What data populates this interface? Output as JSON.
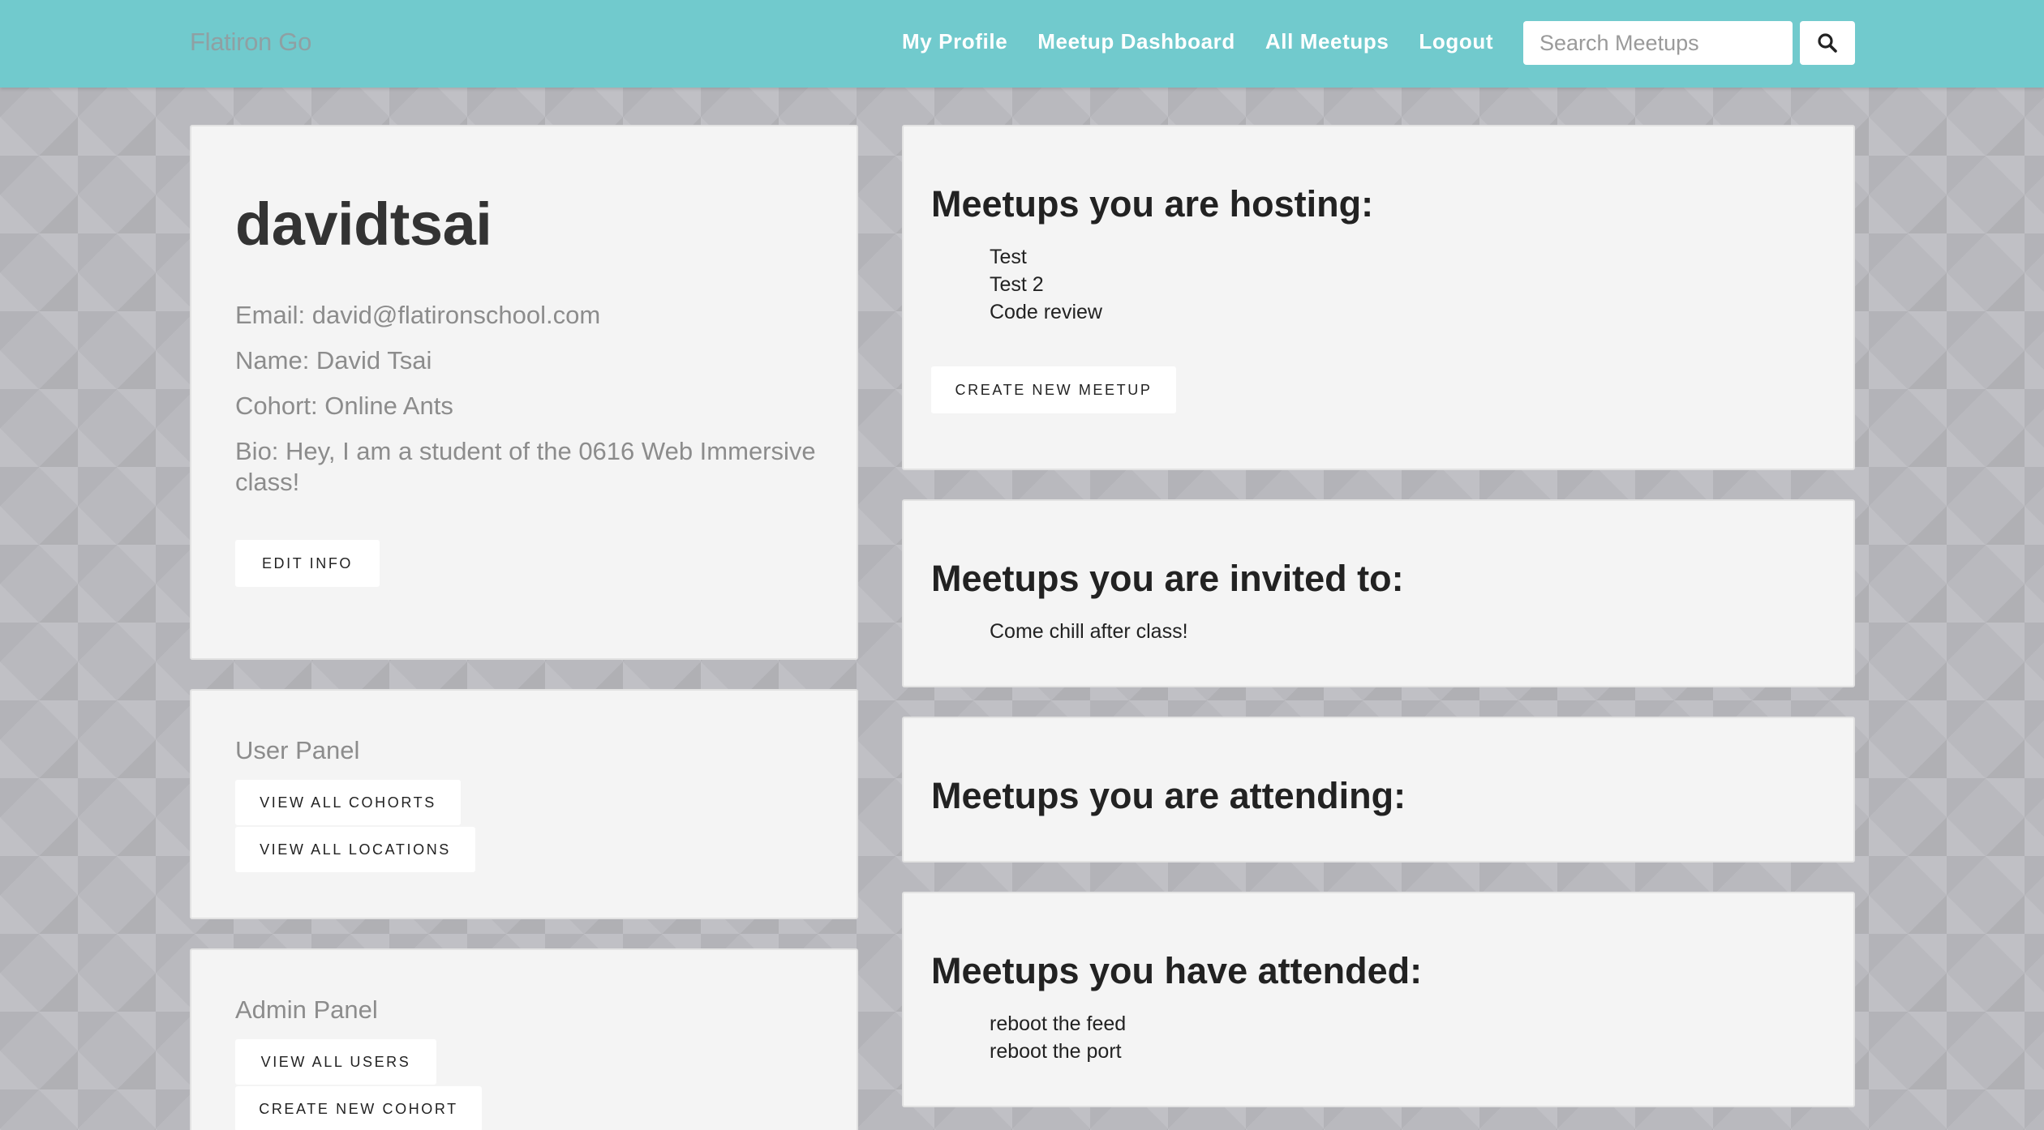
{
  "navbar": {
    "brand": "Flatiron Go",
    "links": [
      "My Profile",
      "Meetup Dashboard",
      "All Meetups",
      "Logout"
    ],
    "search": {
      "placeholder": "Search Meetups",
      "value": ""
    },
    "search_icon": "search-icon"
  },
  "profile": {
    "username": "davidtsai",
    "email_line": "Email: david@flatironschool.com",
    "name_line": "Name: David Tsai",
    "cohort_line": "Cohort: Online Ants",
    "bio_line": "Bio: Hey, I am a student of the 0616 Web Immersive class!",
    "edit_button": "Edit Info"
  },
  "user_panel": {
    "title": "User Panel",
    "buttons": [
      "View All Cohorts",
      "View All Locations"
    ]
  },
  "admin_panel": {
    "title": "Admin Panel",
    "buttons": [
      "View All Users",
      "Create New Cohort"
    ]
  },
  "hosting": {
    "heading": "Meetups you are hosting:",
    "items": [
      "Test",
      "Test 2",
      "Code review"
    ],
    "button": "Create New Meetup"
  },
  "invited": {
    "heading": "Meetups you are invited to:",
    "items": [
      "Come chill after class!"
    ]
  },
  "attending": {
    "heading": "Meetups you are attending:",
    "items": []
  },
  "attended": {
    "heading": "Meetups you have attended:",
    "items": [
      "reboot the feed",
      "reboot the port"
    ]
  },
  "colors": {
    "navbar": "#71cacd",
    "card": "#f4f4f4",
    "background": "#b9b9be"
  }
}
